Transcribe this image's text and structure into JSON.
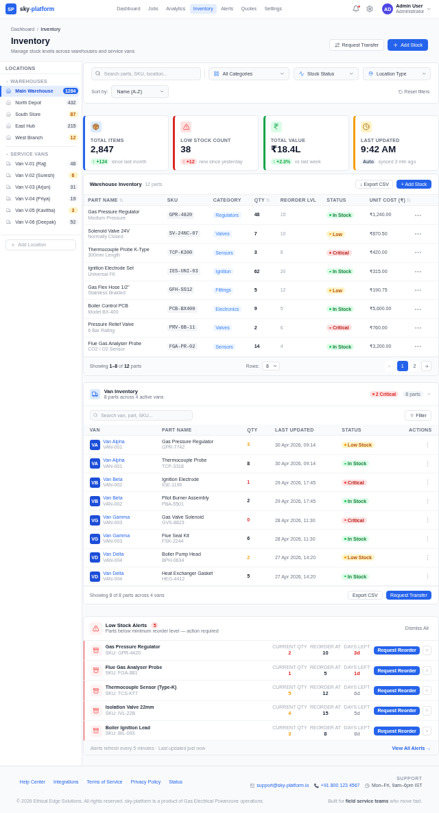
{
  "header": {
    "logo": "SP",
    "brand": "sky",
    "brand_accent": "-platform",
    "nav": [
      {
        "label": "Dashboard",
        "selected": false
      },
      {
        "label": "Jobs",
        "selected": false
      },
      {
        "label": "Analytics",
        "selected": false
      },
      {
        "label": "Inventory",
        "selected": true
      },
      {
        "label": "Alerts",
        "selected": false
      },
      {
        "label": "Quotes",
        "selected": false
      },
      {
        "label": "Settings",
        "selected": false
      }
    ],
    "notifications_unread": true,
    "user": {
      "initials": "AD",
      "name": "Admin User",
      "role": "Administrator"
    }
  },
  "page": {
    "breadcrumb": {
      "items": [
        "Dashboard",
        "Inventory"
      ],
      "separator": "/"
    },
    "title": "Inventory",
    "subtitle": "Manage stock levels across warehouses and service vans",
    "transfer_button": "Request Transfer",
    "add_button": "Add Stock"
  },
  "sidebar": {
    "title": "LOCATIONS",
    "groups": [
      {
        "label": "WAREHOUSES",
        "kind": "warehouse",
        "expanded": true,
        "items": [
          {
            "label": "Main Warehouse",
            "count": "1284",
            "selected": true,
            "low_stock": false
          },
          {
            "label": "North Depot",
            "count": "432",
            "selected": false,
            "low_stock": false
          },
          {
            "label": "South Store",
            "count": "87",
            "selected": false,
            "low_stock": true
          },
          {
            "label": "East Hub",
            "count": "215",
            "selected": false,
            "low_stock": false
          },
          {
            "label": "West Branch",
            "count": "12",
            "selected": false,
            "low_stock": true
          }
        ]
      },
      {
        "label": "SERVICE VANS",
        "kind": "van",
        "expanded": true,
        "items": [
          {
            "label": "Van V-01 (Raj)",
            "count": "48",
            "selected": false,
            "low_stock": false
          },
          {
            "label": "Van V-02 (Suresh)",
            "count": "6",
            "selected": false,
            "low_stock": true
          },
          {
            "label": "Van V-03 (Arjun)",
            "count": "31",
            "selected": false,
            "low_stock": false
          },
          {
            "label": "Van V-04 (Priya)",
            "count": "19",
            "selected": false,
            "low_stock": false
          },
          {
            "label": "Van V-05 (Kavitha)",
            "count": "3",
            "selected": false,
            "low_stock": true
          },
          {
            "label": "Van V-06 (Deepak)",
            "count": "52",
            "selected": false,
            "low_stock": false
          }
        ]
      }
    ],
    "add_button": "Add Location"
  },
  "filters": {
    "search_placeholder": "Search parts, SKU, location...",
    "selects": [
      {
        "kind": "category",
        "value": "All Categories"
      },
      {
        "kind": "status",
        "value": "Stock Status"
      },
      {
        "kind": "location",
        "value": "Location Type"
      }
    ],
    "sort_label": "Sort by:",
    "sort_value": "Name (A-Z)",
    "reset_button": "Reset filters"
  },
  "stats": [
    {
      "kind": "items",
      "label": "TOTAL ITEMS",
      "value": "2,847",
      "change": "↑ +124",
      "note": "since last month"
    },
    {
      "kind": "low_stock",
      "label": "LOW STOCK COUNT",
      "value": "38",
      "change": "↑ +12",
      "note": "new since yesterday"
    },
    {
      "kind": "value",
      "label": "TOTAL VALUE",
      "value": "₹18.4L",
      "change": "↑ +2.3%",
      "note": "vs last week"
    },
    {
      "kind": "updated",
      "label": "LAST UPDATED",
      "value": "9:42 AM",
      "change": "Auto",
      "note": "synced 3 min ago"
    }
  ],
  "warehouse": {
    "title": "Warehouse Inventory",
    "count": "12 parts",
    "export_button": "↓ Export CSV",
    "add_button": "+ Add Stock",
    "columns": [
      {
        "label": "PART NAME",
        "sortable": true
      },
      {
        "label": "SKU",
        "sortable": false
      },
      {
        "label": "CATEGORY",
        "sortable": false
      },
      {
        "label": "QTY",
        "sortable": true
      },
      {
        "label": "REORDER LVL",
        "sortable": false
      },
      {
        "label": "STATUS",
        "sortable": false
      },
      {
        "label": "UNIT COST (₹)",
        "sortable": true
      }
    ],
    "rows": [
      {
        "name": "Gas Pressure Regulator",
        "detail": "Medium Pressure",
        "sku": "GPR-4820",
        "category": "Regulators",
        "qty": "48",
        "reorder": "15",
        "status": "In Stock",
        "kind": "ok",
        "unit_cost": "₹1,240.00"
      },
      {
        "name": "Solenoid Valve 24V",
        "detail": "Normally Closed",
        "sku": "SV-24NC-07",
        "category": "Valves",
        "qty": "7",
        "reorder": "10",
        "status": "Low",
        "kind": "low",
        "unit_cost": "₹870.50"
      },
      {
        "name": "Thermocouple Probe K-Type",
        "detail": "300mm Length",
        "sku": "TCP-K300",
        "category": "Sensors",
        "qty": "3",
        "reorder": "8",
        "status": "Critical",
        "kind": "critical",
        "unit_cost": "₹420.00"
      },
      {
        "name": "Ignition Electrode Set",
        "detail": "Universal Fit",
        "sku": "IES-UNI-03",
        "category": "Ignition",
        "qty": "62",
        "reorder": "20",
        "status": "In Stock",
        "kind": "ok",
        "unit_cost": "₹315.00"
      },
      {
        "name": "Gas Flex Hose 1/2\"",
        "detail": "Stainless Braided",
        "sku": "GFH-SS12",
        "category": "Fittings",
        "qty": "5",
        "reorder": "12",
        "status": "Low",
        "kind": "low",
        "unit_cost": "₹190.75"
      },
      {
        "name": "Boiler Control PCB",
        "detail": "Model BX-400",
        "sku": "PCB-BX400",
        "category": "Electronics",
        "qty": "9",
        "reorder": "5",
        "status": "In Stock",
        "kind": "ok",
        "unit_cost": "₹5,600.00"
      },
      {
        "name": "Pressure Relief Valve",
        "detail": "6 Bar Rating",
        "sku": "PRV-6B-11",
        "category": "Valves",
        "qty": "2",
        "reorder": "6",
        "status": "Critical",
        "kind": "critical",
        "unit_cost": "₹760.00"
      },
      {
        "name": "Flue Gas Analyser Probe",
        "detail": "CO2 / O2 Sensor",
        "sku": "FGA-PR-02",
        "category": "Sensors",
        "qty": "14",
        "reorder": "4",
        "status": "In Stock",
        "kind": "ok",
        "unit_cost": "₹3,200.00"
      }
    ],
    "footer": {
      "summary": "Showing **1–8** of **12** parts",
      "rows_label": "Rows:",
      "rows_value": "8",
      "prev_disabled": true,
      "next_disabled": false,
      "pages": [
        {
          "label": "1",
          "selected": true
        },
        {
          "label": "2",
          "selected": false
        }
      ]
    }
  },
  "van_inventory": {
    "title": "Van Inventory",
    "subtitle": "8 parts across 4 active vans",
    "critical_count": "2 Critical",
    "parts_count": "8 parts",
    "expanded": true,
    "search_placeholder": "Search van, part, SKU...",
    "filter_button": "Filter",
    "columns": [
      "VAN",
      "PART NAME",
      "QTY",
      "LAST UPDATED",
      "STATUS",
      "ACTIONS"
    ],
    "rows": [
      {
        "initials": "VA",
        "van": "Van Alpha",
        "van_id": "VAN-001",
        "part": "Gas Pressure Regulator",
        "part_code": "GPR-7742",
        "qty": "3",
        "updated": "30 Apr 2026, 09:14",
        "status": "Low Stock",
        "kind": "low"
      },
      {
        "initials": "VA",
        "van": "Van Alpha",
        "van_id": "VAN-001",
        "part": "Thermocouple Probe",
        "part_code": "TCP-3318",
        "qty": "8",
        "updated": "30 Apr 2026, 09:14",
        "status": "In Stock",
        "kind": "ok"
      },
      {
        "initials": "VB",
        "van": "Van Beta",
        "van_id": "VAN-002",
        "part": "Ignition Electrode",
        "part_code": "IGE-1190",
        "qty": "1",
        "updated": "29 Apr 2026, 17:45",
        "status": "Critical",
        "kind": "critical"
      },
      {
        "initials": "VB",
        "van": "Van Beta",
        "van_id": "VAN-002",
        "part": "Pilot Burner Assembly",
        "part_code": "PBA-5501",
        "qty": "2",
        "updated": "29 Apr 2026, 17:45",
        "status": "In Stock",
        "kind": "ok"
      },
      {
        "initials": "VG",
        "van": "Van Gamma",
        "van_id": "VAN-003",
        "part": "Gas Valve Solenoid",
        "part_code": "GVS-8823",
        "qty": "0",
        "updated": "28 Apr 2026, 11:30",
        "status": "Critical",
        "kind": "critical"
      },
      {
        "initials": "VG",
        "van": "Van Gamma",
        "van_id": "VAN-003",
        "part": "Flue Seal Kit",
        "part_code": "FSK-2244",
        "qty": "6",
        "updated": "28 Apr 2026, 11:30",
        "status": "In Stock",
        "kind": "ok"
      },
      {
        "initials": "VD",
        "van": "Van Delta",
        "van_id": "VAN-004",
        "part": "Boiler Pump Head",
        "part_code": "BPH-0634",
        "qty": "2",
        "updated": "27 Apr 2026, 14:20",
        "status": "Low Stock",
        "kind": "low"
      },
      {
        "initials": "VD",
        "van": "Van Delta",
        "van_id": "VAN-004",
        "part": "Heat Exchanger Gasket",
        "part_code": "HEG-4412",
        "qty": "5",
        "updated": "27 Apr 2026, 14:20",
        "status": "In Stock",
        "kind": "ok"
      }
    ],
    "summary": "Showing 8 of 8 parts across 4 vans",
    "export_button": "Export CSV",
    "transfer_button": "Request Transfer"
  },
  "alerts": {
    "title": "Low Stock Alerts",
    "count": "5",
    "subtitle": "Parts below minimum reorder level — action required",
    "dismiss_all": "Dismiss All",
    "rows": [
      {
        "name": "Gas Pressure Regulator",
        "sku": "SKU: GPR-4420",
        "metrics": [
          {
            "label": "CURRENT QTY",
            "value": "2",
            "kind": "critical"
          },
          {
            "label": "REORDER AT",
            "value": "10",
            "kind": "strong"
          },
          {
            "label": "DAYS LEFT",
            "value": "3d",
            "kind": "critical"
          }
        ],
        "button": "Request Reorder"
      },
      {
        "name": "Flue Gas Analyser Probe",
        "sku": "SKU: FGA-881",
        "metrics": [
          {
            "label": "CURRENT QTY",
            "value": "1",
            "kind": "critical"
          },
          {
            "label": "REORDER AT",
            "value": "5",
            "kind": "strong"
          },
          {
            "label": "DAYS LEFT",
            "value": "1d",
            "kind": "critical"
          }
        ],
        "button": "Request Reorder"
      },
      {
        "name": "Thermocouple Sensor (Type-K)",
        "sku": "SKU: TCS-KT7",
        "metrics": [
          {
            "label": "CURRENT QTY",
            "value": "5",
            "kind": "warning"
          },
          {
            "label": "REORDER AT",
            "value": "12",
            "kind": "strong"
          },
          {
            "label": "DAYS LEFT",
            "value": "6d",
            "kind": "muted"
          }
        ],
        "button": "Request Reorder"
      },
      {
        "name": "Isolation Valve 22mm",
        "sku": "SKU: IVL-22B",
        "metrics": [
          {
            "label": "CURRENT QTY",
            "value": "4",
            "kind": "warning"
          },
          {
            "label": "REORDER AT",
            "value": "15",
            "kind": "strong"
          },
          {
            "label": "DAYS LEFT",
            "value": "5d",
            "kind": "muted"
          }
        ],
        "button": "Request Reorder"
      },
      {
        "name": "Boiler Ignition Lead",
        "sku": "SKU: BIL-093",
        "metrics": [
          {
            "label": "CURRENT QTY",
            "value": "3",
            "kind": "warning"
          },
          {
            "label": "REORDER AT",
            "value": "8",
            "kind": "strong"
          },
          {
            "label": "DAYS LEFT",
            "value": "8d",
            "kind": "muted"
          }
        ],
        "button": "Request Reorder"
      }
    ],
    "footer_note": "Alerts refresh every 5 minutes · Last updated just now",
    "view_all": "View All Alerts →"
  },
  "footer": {
    "links": [
      "Help Center",
      "Integrations",
      "Terms of Service",
      "Privacy Policy",
      "Status"
    ],
    "support_title": "SUPPORT",
    "contacts": [
      {
        "kind": "email",
        "text": "support@sky-platform.io"
      },
      {
        "kind": "phone",
        "text": "+91 800 123 4567"
      },
      {
        "kind": "hours",
        "text": "Mon–Fri, 9am–6pm IST"
      }
    ],
    "copyright": "© 2026 Ethical Edge Solutions. All rights reserved. sky-platform is a product of Gas Electrical Powerzone operations.",
    "tagline": "Built for **field service teams** who move fast."
  }
}
